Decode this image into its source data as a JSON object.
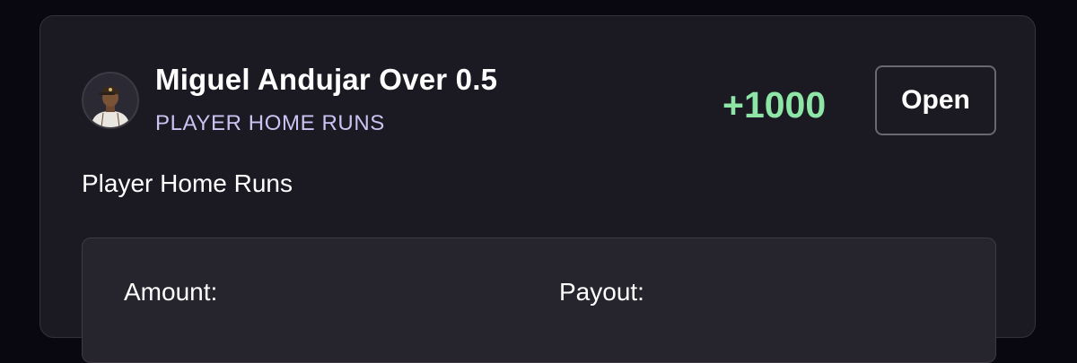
{
  "bet": {
    "player_avatar_icon": "player-headshot-icon",
    "title": "Miguel Andujar Over 0.5",
    "market": "PLAYER HOME RUNS",
    "odds": "+1000",
    "status_label": "Open",
    "description": "Player Home Runs"
  },
  "details": {
    "amount_label": "Amount:",
    "payout_label": "Payout:"
  },
  "colors": {
    "background": "#090810",
    "card": "#1b1922",
    "odds_positive": "#8ee6a6",
    "market_label": "#c9c4f2",
    "details_box": "#26242c"
  }
}
